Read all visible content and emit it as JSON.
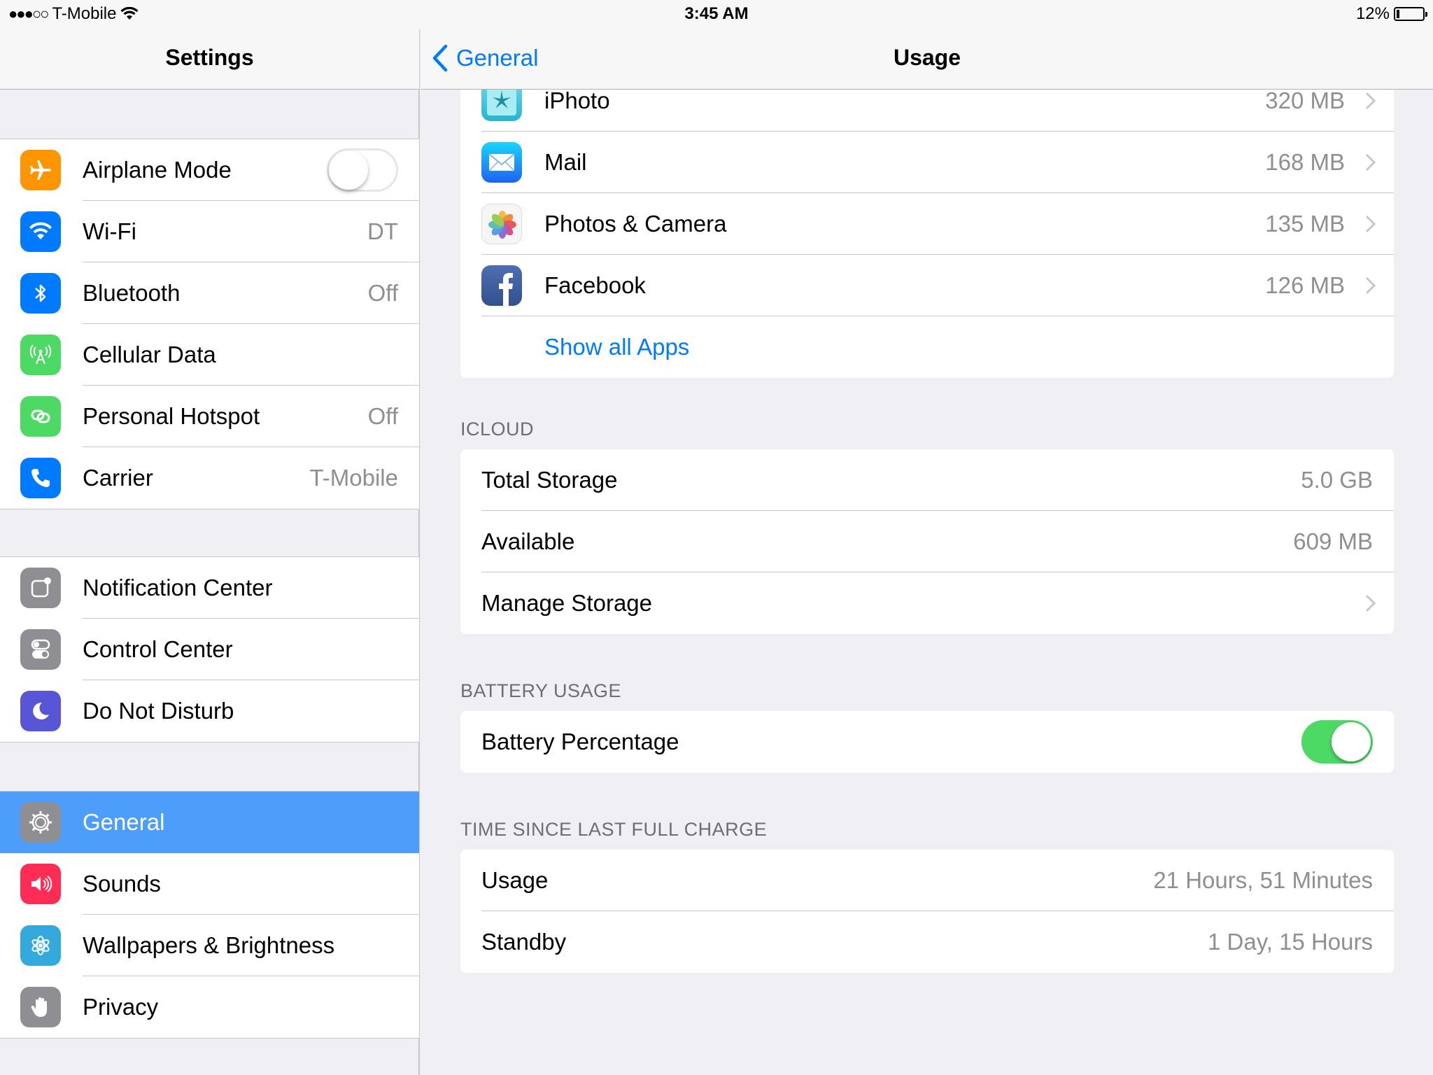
{
  "status": {
    "signal": "●●●○○",
    "carrier": "T-Mobile",
    "time": "3:45 AM",
    "battery_text": "12%",
    "battery_level": 0.12
  },
  "master": {
    "title": "Settings",
    "groups": [
      [
        {
          "label": "Airplane Mode",
          "icon": "airplane-icon",
          "color": "#ff9500",
          "toggle": false
        },
        {
          "label": "Wi-Fi",
          "value": "DT",
          "icon": "wifi-icon",
          "color": "#007aff"
        },
        {
          "label": "Bluetooth",
          "value": "Off",
          "icon": "bluetooth-icon",
          "color": "#007aff"
        },
        {
          "label": "Cellular Data",
          "icon": "cellular-icon",
          "color": "#4cd964"
        },
        {
          "label": "Personal Hotspot",
          "value": "Off",
          "icon": "hotspot-icon",
          "color": "#4cd964"
        },
        {
          "label": "Carrier",
          "value": "T-Mobile",
          "icon": "phone-icon",
          "color": "#007aff"
        }
      ],
      [
        {
          "label": "Notification Center",
          "icon": "notification-icon",
          "color": "#8e8e93"
        },
        {
          "label": "Control Center",
          "icon": "control-center-icon",
          "color": "#8e8e93"
        },
        {
          "label": "Do Not Disturb",
          "icon": "moon-icon",
          "color": "#5856d6"
        }
      ],
      [
        {
          "label": "General",
          "icon": "gear-icon",
          "color": "#8e8e93",
          "selected": true
        },
        {
          "label": "Sounds",
          "icon": "speaker-icon",
          "color": "#ff2d55"
        },
        {
          "label": "Wallpapers & Brightness",
          "icon": "flower-icon",
          "color": "#34aadc"
        },
        {
          "label": "Privacy",
          "icon": "hand-icon",
          "color": "#8e8e93"
        }
      ]
    ]
  },
  "detail": {
    "back_label": "General",
    "title": "Usage",
    "apps": [
      {
        "name": "iPhoto",
        "size": "320 MB",
        "icon": "iphoto-icon"
      },
      {
        "name": "Mail",
        "size": "168 MB",
        "icon": "mail-icon"
      },
      {
        "name": "Photos & Camera",
        "size": "135 MB",
        "icon": "photos-icon"
      },
      {
        "name": "Facebook",
        "size": "126 MB",
        "icon": "facebook-icon"
      }
    ],
    "show_all": "Show all Apps",
    "icloud": {
      "header": "ICLOUD",
      "total_label": "Total Storage",
      "total_value": "5.0 GB",
      "available_label": "Available",
      "available_value": "609 MB",
      "manage_label": "Manage Storage"
    },
    "battery": {
      "header": "BATTERY USAGE",
      "percentage_label": "Battery Percentage",
      "percentage_on": true
    },
    "charge": {
      "header": "TIME SINCE LAST FULL CHARGE",
      "usage_label": "Usage",
      "usage_value": "21 Hours, 51 Minutes",
      "standby_label": "Standby",
      "standby_value": "1 Day, 15 Hours"
    }
  }
}
